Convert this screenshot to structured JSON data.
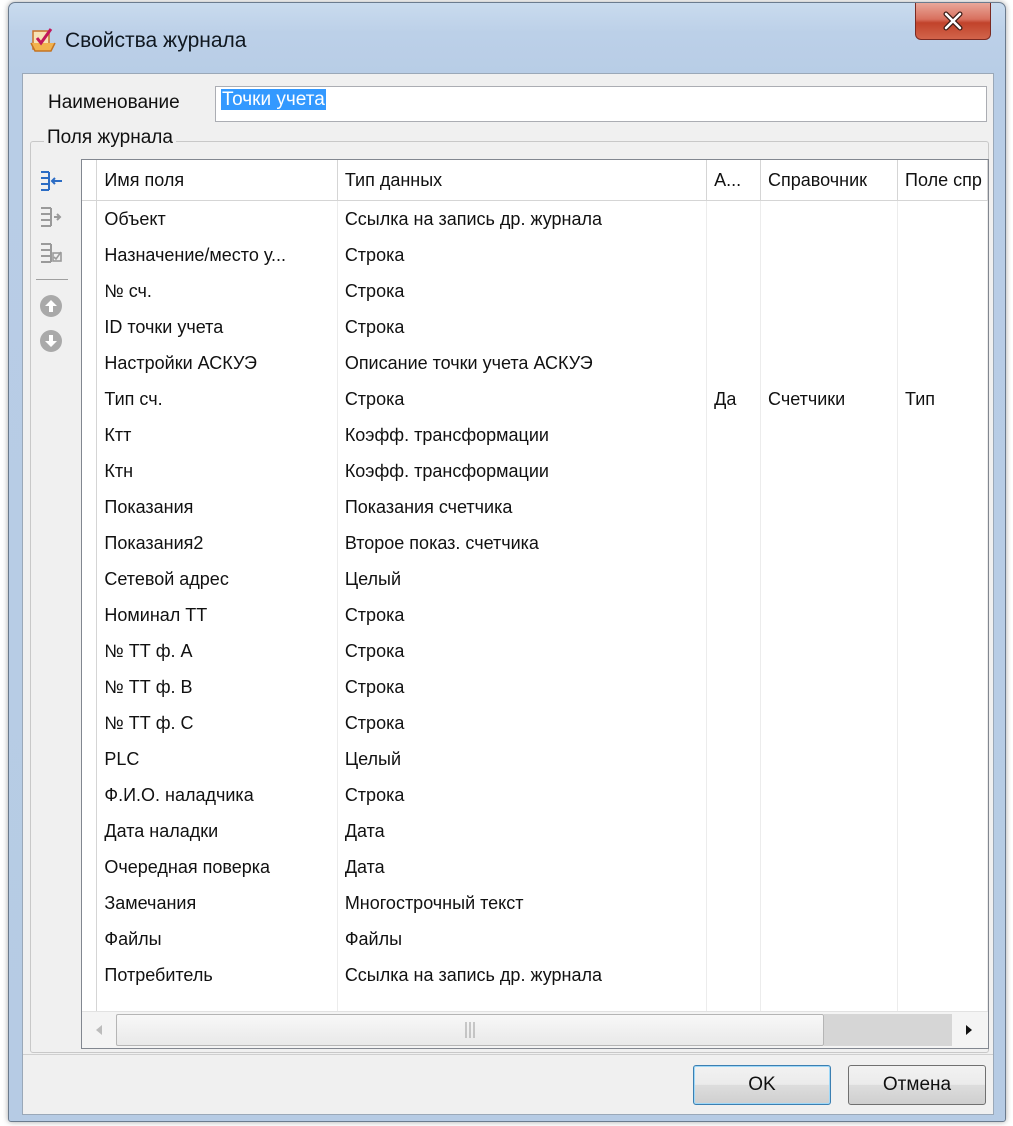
{
  "window": {
    "title": "Свойства журнала",
    "close_label": "X"
  },
  "name_field": {
    "label": "Наименование",
    "value": "Точки учета"
  },
  "fields_group": {
    "title": "Поля журнала",
    "columns": [
      "Имя поля",
      "Тип данных",
      "А...",
      "Справочник",
      "Поле спр"
    ],
    "rows": [
      [
        "Объект",
        "Ссылка на запись др. журнала",
        "",
        "",
        ""
      ],
      [
        "Назначение/место у...",
        "Строка",
        "",
        "",
        ""
      ],
      [
        "№ сч.",
        "Строка",
        "",
        "",
        ""
      ],
      [
        "ID точки учета",
        "Строка",
        "",
        "",
        ""
      ],
      [
        "Настройки АСКУЭ",
        "Описание точки учета АСКУЭ",
        "",
        "",
        ""
      ],
      [
        "Тип сч.",
        "Строка",
        "Да",
        "Счетчики",
        "Тип"
      ],
      [
        "Ктт",
        "Коэфф. трансформации",
        "",
        "",
        ""
      ],
      [
        "Ктн",
        "Коэфф. трансформации",
        "",
        "",
        ""
      ],
      [
        "Показания",
        "Показания счетчика",
        "",
        "",
        ""
      ],
      [
        "Показания2",
        "Второе показ. счетчика",
        "",
        "",
        ""
      ],
      [
        "Сетевой адрес",
        "Целый",
        "",
        "",
        ""
      ],
      [
        "Номинал ТТ",
        "Строка",
        "",
        "",
        ""
      ],
      [
        "№ ТТ ф. А",
        "Строка",
        "",
        "",
        ""
      ],
      [
        "№ ТТ ф. В",
        "Строка",
        "",
        "",
        ""
      ],
      [
        "№ ТТ ф. С",
        "Строка",
        "",
        "",
        ""
      ],
      [
        "PLC",
        "Целый",
        "",
        "",
        ""
      ],
      [
        "Ф.И.О. наладчика",
        "Строка",
        "",
        "",
        ""
      ],
      [
        "Дата наладки",
        "Дата",
        "",
        "",
        ""
      ],
      [
        "Очередная поверка",
        "Дата",
        "",
        "",
        ""
      ],
      [
        "Замечания",
        "Многострочный текст",
        "",
        "",
        ""
      ],
      [
        "Файлы",
        "Файлы",
        "",
        "",
        ""
      ],
      [
        "Потребитель",
        "Ссылка на запись др. журнала",
        "",
        "",
        ""
      ]
    ]
  },
  "toolbar_icons": [
    "insert-field-icon",
    "add-field-icon",
    "edit-field-icon",
    "move-up-icon",
    "move-down-icon"
  ],
  "buttons": {
    "ok": "OK",
    "cancel": "Отмена"
  },
  "colors": {
    "selection": "#3399ff",
    "title_bar": "#bcd0e8",
    "close_button": "#c1432b"
  }
}
